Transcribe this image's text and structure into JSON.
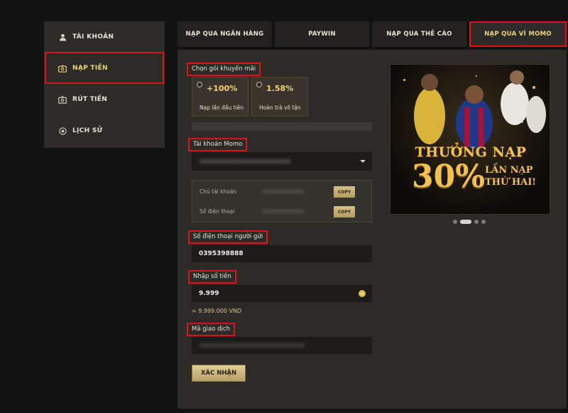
{
  "sidebar": {
    "items": [
      {
        "label": "TÀI KHOẢN",
        "icon": "user-icon"
      },
      {
        "label": "NẠP TIỀN",
        "icon": "deposit-icon"
      },
      {
        "label": "RÚT TIỀN",
        "icon": "withdraw-icon"
      },
      {
        "label": "LỊCH SỬ",
        "icon": "history-icon"
      }
    ]
  },
  "tabs": [
    {
      "label": "NẠP QUA NGÂN HÀNG"
    },
    {
      "label": "PAYWIN"
    },
    {
      "label": "NẠP QUA THẺ CÀO"
    },
    {
      "label": "NẠP QUA VÍ MOMO"
    }
  ],
  "promo": {
    "label": "Chọn gói khuyến mãi",
    "options": [
      {
        "value": "+100%",
        "desc": "Nạp lần đầu tiên"
      },
      {
        "value": "1.58%",
        "desc": "Hoàn trả vô tận"
      }
    ]
  },
  "momo_account": {
    "label": "Tài khoản Momo",
    "owner_label": "Chủ tài khoản",
    "phone_label": "Số điện thoại",
    "copy_label": "COPY"
  },
  "sender_phone": {
    "label": "Số điện thoại người gửi",
    "value": "0395398888"
  },
  "amount": {
    "label": "Nhập số tiền",
    "value": "9.999",
    "converted": "= 9.999.000 VND"
  },
  "transaction_code": {
    "label": "Mã giao dịch"
  },
  "submit_label": "XÁC NHẬN",
  "banner": {
    "line1": "THƯỞNG NẠP",
    "percent": "30%",
    "line2a": "LẦN NẠP",
    "line2b": "THỨ HAI!"
  },
  "carousel": {
    "count": 4,
    "active": 1
  },
  "colors": {
    "accent_gold": "#f0d27a",
    "highlight_red": "#e0101c",
    "panel": "#2c2b28",
    "background": "#121212"
  }
}
